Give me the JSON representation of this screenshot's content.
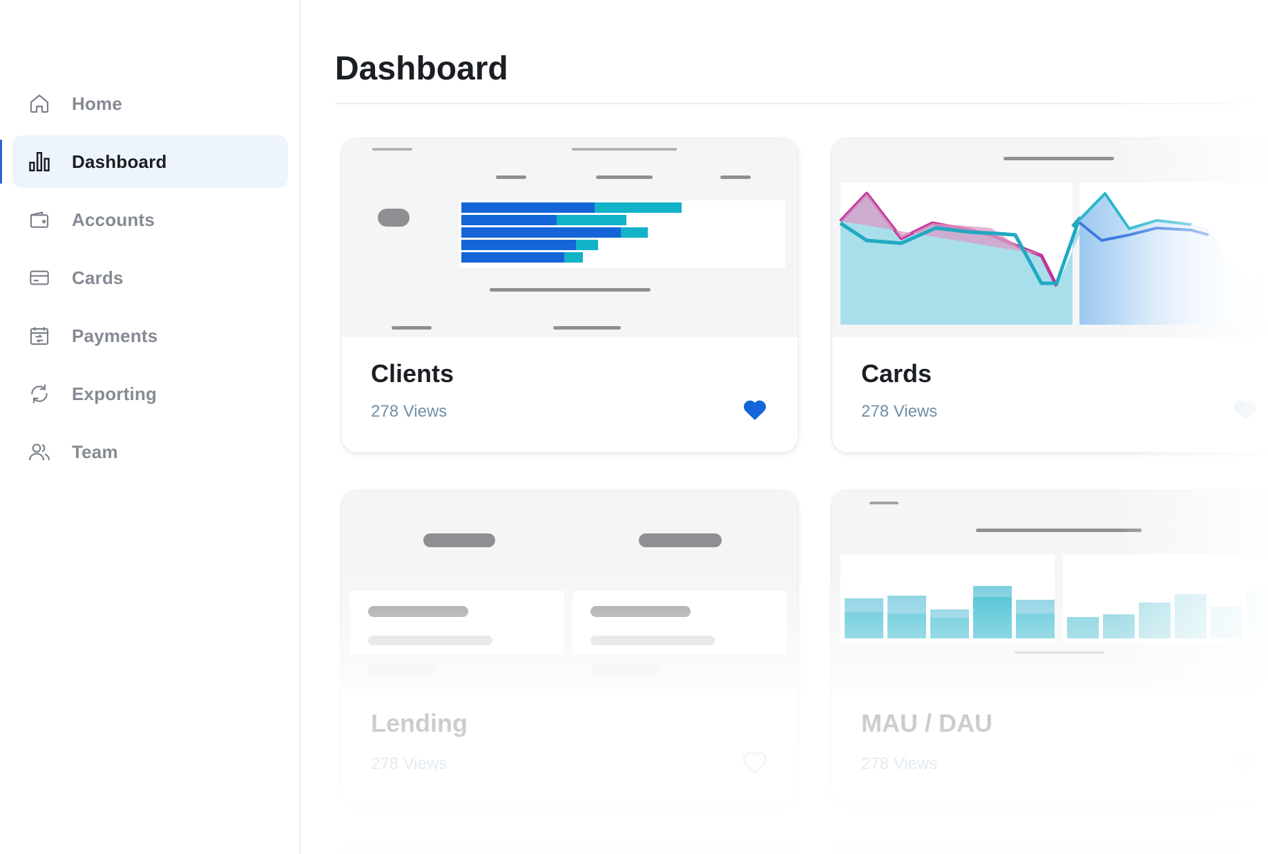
{
  "sidebar": {
    "items": [
      {
        "label": "Home",
        "icon": "home-icon"
      },
      {
        "label": "Dashboard",
        "icon": "bar-chart-icon",
        "active": true
      },
      {
        "label": "Accounts",
        "icon": "wallet-icon"
      },
      {
        "label": "Cards",
        "icon": "credit-card-icon"
      },
      {
        "label": "Payments",
        "icon": "payments-calendar-icon"
      },
      {
        "label": "Exporting",
        "icon": "refresh-icon"
      },
      {
        "label": "Team",
        "icon": "users-icon"
      }
    ]
  },
  "header": {
    "title": "Dashboard"
  },
  "cards": [
    {
      "title": "Clients",
      "views": "278 Views",
      "favorited": true
    },
    {
      "title": "Cards",
      "views": "278 Views",
      "favorited": false
    },
    {
      "title": "Lending",
      "views": "278 Views",
      "favorited": false
    },
    {
      "title": "MAU / DAU",
      "views": "278 Views",
      "favorited": false
    }
  ],
  "colors": {
    "accent": "#2a63d8",
    "bar_primary": "#1565d8",
    "bar_secondary": "#12b2c8",
    "area_teal": "#a9dfeb",
    "area_magenta": "#c0389a",
    "heart": "#1565d8"
  }
}
